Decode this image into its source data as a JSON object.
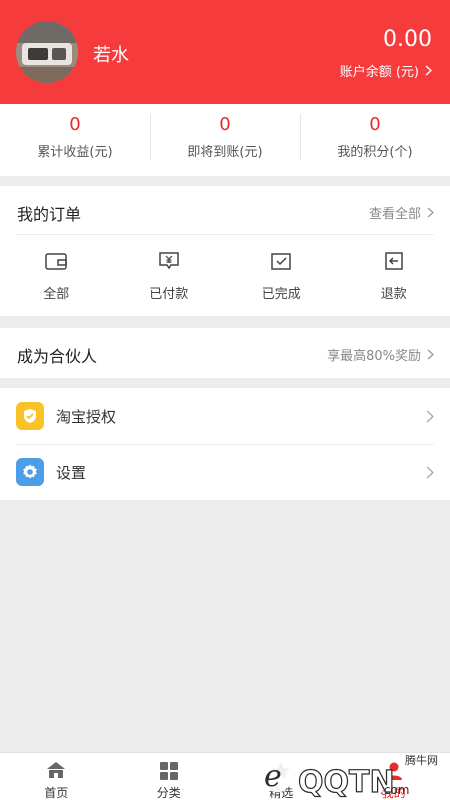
{
  "header": {
    "username": "若水",
    "balance": "0.00",
    "balance_label": "账户余额 (元)"
  },
  "stats": [
    {
      "value": "0",
      "label": "累计收益(元)"
    },
    {
      "value": "0",
      "label": "即将到账(元)"
    },
    {
      "value": "0",
      "label": "我的积分(个)"
    }
  ],
  "orders": {
    "title": "我的订单",
    "view_all": "查看全部",
    "items": [
      {
        "label": "全部",
        "icon": "wallet-icon"
      },
      {
        "label": "已付款",
        "icon": "yuan-card-icon"
      },
      {
        "label": "已完成",
        "icon": "check-box-icon"
      },
      {
        "label": "退款",
        "icon": "return-icon"
      }
    ]
  },
  "partner": {
    "title": "成为合伙人",
    "reward": "享最高80%奖励"
  },
  "menu": [
    {
      "label": "淘宝授权",
      "icon": "shield-check-icon",
      "color": "#f7c326"
    },
    {
      "label": "设置",
      "icon": "gear-icon",
      "color": "#4a9fe8"
    }
  ],
  "tabbar": [
    {
      "label": "首页",
      "icon": "home-icon"
    },
    {
      "label": "分类",
      "icon": "grid-icon"
    },
    {
      "label": "精选",
      "icon": "star-icon"
    },
    {
      "label": "我的",
      "icon": "user-icon",
      "active": true
    }
  ],
  "watermark": {
    "text": "腾牛网",
    "logo": "QQTN"
  },
  "colors": {
    "accent": "#f53b3b",
    "value_red": "#e82b2b",
    "background": "#ececec"
  }
}
